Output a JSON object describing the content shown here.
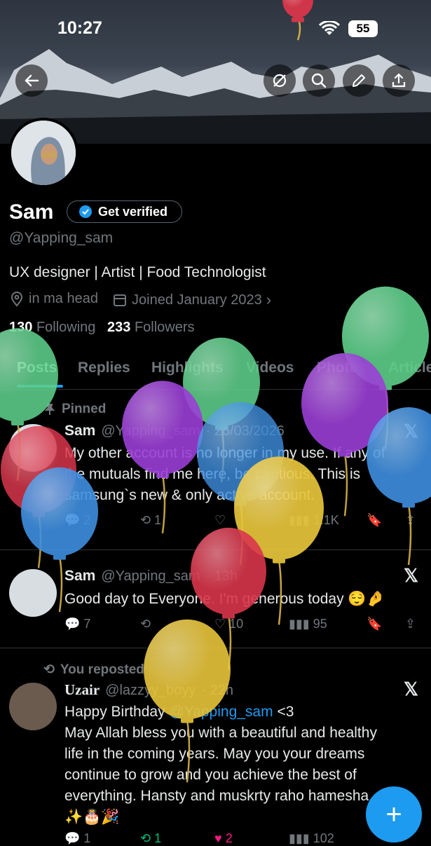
{
  "status_bar": {
    "time": "10:27",
    "battery": "55"
  },
  "header": {
    "buttons": [
      "back",
      "mute",
      "search",
      "edit",
      "share"
    ]
  },
  "profile": {
    "name": "Sam",
    "verify_label": "Get verified",
    "handle": "@Yapping_sam",
    "bio": "UX designer | Artist | Food Technologist",
    "location": "in ma head",
    "joined": "Joined January 2023",
    "following_count": "130",
    "following_label": "Following",
    "followers_count": "233",
    "followers_label": "Followers"
  },
  "tabs": [
    "Posts",
    "Replies",
    "Highlights",
    "Videos",
    "Photos",
    "Articles"
  ],
  "posts": [
    {
      "context": "Pinned",
      "name": "Sam",
      "handle": "@Yapping_sam",
      "time": "· 26/03/2026",
      "text_lines": [
        "My other account is no longer in my use. If any of",
        "the mutuals find me here, be cautious. This is",
        "samsung`s new & only active account."
      ],
      "replies": "2",
      "reposts": "1",
      "likes": "",
      "views": "1.1K"
    },
    {
      "name": "Sam",
      "handle": "@Yapping_sam",
      "time": "· 13h",
      "text": "Good day to Everyone. I'm generous today 😌🤌",
      "replies": "7",
      "reposts": "",
      "likes": "10",
      "views": "95"
    },
    {
      "context": "You reposted",
      "name": "Uzair",
      "handle": "@lazzyy_boyy",
      "time": "· 22h",
      "line1_prefix": "Happy Birthday ",
      "mention": "@Yapping_sam",
      "line1_suffix": " <3",
      "text_lines": [
        "May Allah bless you with a beautiful and healthy",
        "life in the coming years. May you your dreams",
        "continue to grow and you achieve the best of",
        "everything. Hansty and muskrty raho hamesha"
      ],
      "emoji_line": "✨🎂🎉",
      "replies": "1",
      "reposts": "1",
      "likes": "2",
      "views": "102"
    }
  ],
  "fab_label": "+",
  "colors": {
    "accent": "#1d9bf0",
    "muted": "#71767b",
    "divider": "#2f3336",
    "balloon_green": "#5ecf8a",
    "balloon_purple": "#9b3fd6",
    "balloon_blue": "#3f8fe0",
    "balloon_yellow": "#e8c53a",
    "balloon_red": "#d9364b"
  }
}
